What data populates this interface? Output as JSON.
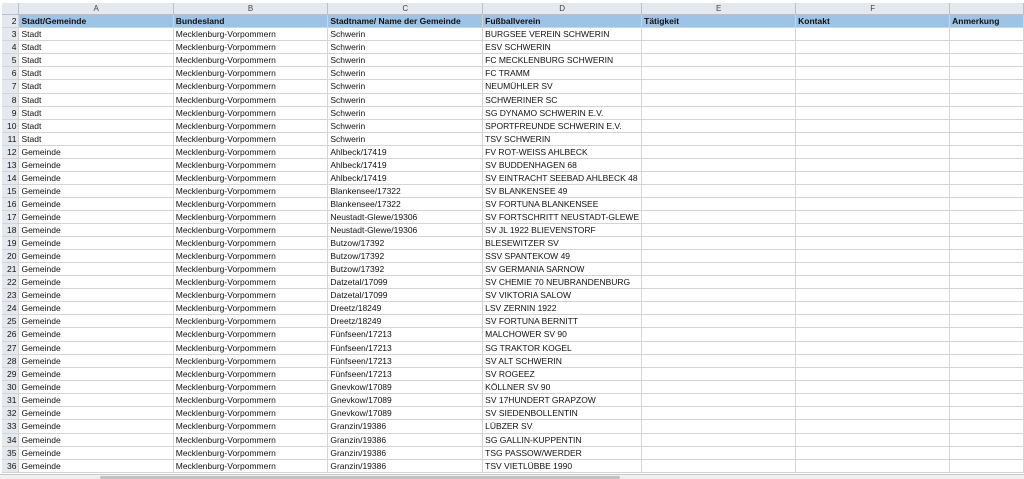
{
  "columns": [
    "A",
    "B",
    "C",
    "D",
    "E",
    "F",
    ""
  ],
  "headers": [
    "Stadt/Gemeinde",
    "Bundesland",
    "Stadtname/ Name der Gemeinde",
    "Fußballverein",
    "Tätigkeit",
    "Kontakt",
    "Anmerkung"
  ],
  "header_row_number": "2",
  "rows": [
    [
      "3",
      "Stadt",
      "Mecklenburg-Vorpommern",
      "Schwerin",
      "BURGSEE VEREIN SCHWERIN",
      "",
      "",
      ""
    ],
    [
      "4",
      "Stadt",
      "Mecklenburg-Vorpommern",
      "Schwerin",
      "ESV SCHWERIN",
      "",
      "",
      ""
    ],
    [
      "5",
      "Stadt",
      "Mecklenburg-Vorpommern",
      "Schwerin",
      "FC MECKLENBURG SCHWERIN",
      "",
      "",
      ""
    ],
    [
      "6",
      "Stadt",
      "Mecklenburg-Vorpommern",
      "Schwerin",
      "FC TRAMM",
      "",
      "",
      ""
    ],
    [
      "7",
      "Stadt",
      "Mecklenburg-Vorpommern",
      "Schwerin",
      "NEUMÜHLER SV",
      "",
      "",
      ""
    ],
    [
      "8",
      "Stadt",
      "Mecklenburg-Vorpommern",
      "Schwerin",
      "SCHWERINER SC",
      "",
      "",
      ""
    ],
    [
      "9",
      "Stadt",
      "Mecklenburg-Vorpommern",
      "Schwerin",
      "SG DYNAMO SCHWERIN E.V.",
      "",
      "",
      ""
    ],
    [
      "10",
      "Stadt",
      "Mecklenburg-Vorpommern",
      "Schwerin",
      "SPORTFREUNDE SCHWERIN E.V.",
      "",
      "",
      ""
    ],
    [
      "11",
      "Stadt",
      "Mecklenburg-Vorpommern",
      "Schwerin",
      "TSV SCHWERIN",
      "",
      "",
      ""
    ],
    [
      "12",
      "Gemeinde",
      "Mecklenburg-Vorpommern",
      "Ahlbeck/17419",
      "FV ROT-WEISS AHLBECK",
      "",
      "",
      ""
    ],
    [
      "13",
      "Gemeinde",
      "Mecklenburg-Vorpommern",
      "Ahlbeck/17419",
      "SV BUDDENHAGEN 68",
      "",
      "",
      ""
    ],
    [
      "14",
      "Gemeinde",
      "Mecklenburg-Vorpommern",
      "Ahlbeck/17419",
      "SV EINTRACHT SEEBAD AHLBECK 48",
      "",
      "",
      ""
    ],
    [
      "15",
      "Gemeinde",
      "Mecklenburg-Vorpommern",
      "Blankensee/17322",
      "SV BLANKENSEE 49",
      "",
      "",
      ""
    ],
    [
      "16",
      "Gemeinde",
      "Mecklenburg-Vorpommern",
      "Blankensee/17322",
      "SV FORTUNA BLANKENSEE",
      "",
      "",
      ""
    ],
    [
      "17",
      "Gemeinde",
      "Mecklenburg-Vorpommern",
      "Neustadt-Glewe/19306",
      "SV FORTSCHRITT NEUSTADT-GLEWE",
      "",
      "",
      ""
    ],
    [
      "18",
      "Gemeinde",
      "Mecklenburg-Vorpommern",
      "Neustadt-Glewe/19306",
      "SV JL 1922 BLIEVENSTORF",
      "",
      "",
      ""
    ],
    [
      "19",
      "Gemeinde",
      "Mecklenburg-Vorpommern",
      "Butzow/17392",
      "BLESEWITZER SV",
      "",
      "",
      ""
    ],
    [
      "20",
      "Gemeinde",
      "Mecklenburg-Vorpommern",
      "Butzow/17392",
      "SSV SPANTEKOW 49",
      "",
      "",
      ""
    ],
    [
      "21",
      "Gemeinde",
      "Mecklenburg-Vorpommern",
      "Butzow/17392",
      "SV GERMANIA SARNOW",
      "",
      "",
      ""
    ],
    [
      "22",
      "Gemeinde",
      "Mecklenburg-Vorpommern",
      "Datzetal/17099",
      "SV CHEMIE 70 NEUBRANDENBURG",
      "",
      "",
      ""
    ],
    [
      "23",
      "Gemeinde",
      "Mecklenburg-Vorpommern",
      "Datzetal/17099",
      "SV VIKTORIA SALOW",
      "",
      "",
      ""
    ],
    [
      "24",
      "Gemeinde",
      "Mecklenburg-Vorpommern",
      "Dreetz/18249",
      "LSV ZERNIN 1922",
      "",
      "",
      ""
    ],
    [
      "25",
      "Gemeinde",
      "Mecklenburg-Vorpommern",
      "Dreetz/18249",
      "SV FORTUNA BERNITT",
      "",
      "",
      ""
    ],
    [
      "26",
      "Gemeinde",
      "Mecklenburg-Vorpommern",
      "Fünfseen/17213",
      "MALCHOWER SV 90",
      "",
      "",
      ""
    ],
    [
      "27",
      "Gemeinde",
      "Mecklenburg-Vorpommern",
      "Fünfseen/17213",
      "SG TRAKTOR KOGEL",
      "",
      "",
      ""
    ],
    [
      "28",
      "Gemeinde",
      "Mecklenburg-Vorpommern",
      "Fünfseen/17213",
      "SV ALT SCHWERIN",
      "",
      "",
      ""
    ],
    [
      "29",
      "Gemeinde",
      "Mecklenburg-Vorpommern",
      "Fünfseen/17213",
      "SV ROGEEZ",
      "",
      "",
      ""
    ],
    [
      "30",
      "Gemeinde",
      "Mecklenburg-Vorpommern",
      "Gnevkow/17089",
      "KÖLLNER SV 90",
      "",
      "",
      ""
    ],
    [
      "31",
      "Gemeinde",
      "Mecklenburg-Vorpommern",
      "Gnevkow/17089",
      "SV 17HUNDERT GRAPZOW",
      "",
      "",
      ""
    ],
    [
      "32",
      "Gemeinde",
      "Mecklenburg-Vorpommern",
      "Gnevkow/17089",
      "SV SIEDENBOLLENTIN",
      "",
      "",
      ""
    ],
    [
      "33",
      "Gemeinde",
      "Mecklenburg-Vorpommern",
      "Granzin/19386",
      "LÜBZER SV",
      "",
      "",
      ""
    ],
    [
      "34",
      "Gemeinde",
      "Mecklenburg-Vorpommern",
      "Granzin/19386",
      "SG GALLIN-KUPPENTIN",
      "",
      "",
      ""
    ],
    [
      "35",
      "Gemeinde",
      "Mecklenburg-Vorpommern",
      "Granzin/19386",
      "TSG PASSOW/WERDER",
      "",
      "",
      ""
    ],
    [
      "36",
      "Gemeinde",
      "Mecklenburg-Vorpommern",
      "Granzin/19386",
      "TSV VIETLÜBBE 1990",
      "",
      "",
      ""
    ]
  ]
}
